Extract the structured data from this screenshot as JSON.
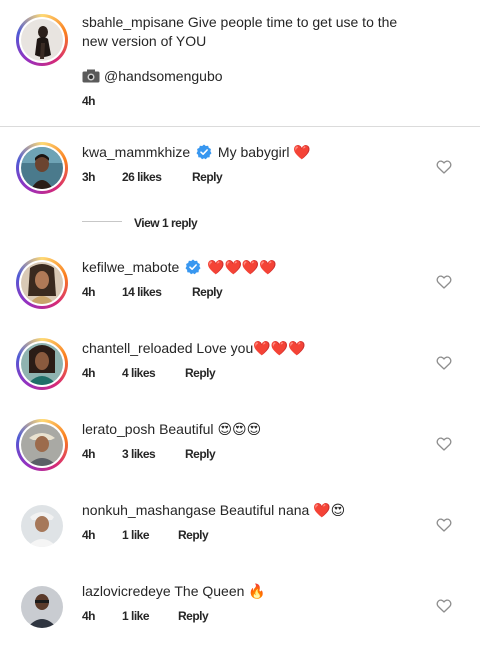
{
  "caption": {
    "username": "sbahle_mpisane",
    "text_line1": "Give people time to get use to the",
    "text_line2": "new version of YOU",
    "credit": "@handsomengubo",
    "time": "4h"
  },
  "comments": [
    {
      "username": "kwa_mammkhize",
      "verified": true,
      "text": "My babygirl",
      "emojis": "❤️",
      "time": "3h",
      "likes": "26 likes",
      "reply": "Reply"
    },
    {
      "username": "kefilwe_mabote",
      "verified": true,
      "text": "",
      "emojis": "❤️❤️❤️❤️",
      "time": "4h",
      "likes": "14 likes",
      "reply": "Reply"
    },
    {
      "username": "chantell_reloaded",
      "verified": false,
      "text": "Love you",
      "emojis": "❤️❤️❤️",
      "time": "4h",
      "likes": "4 likes",
      "reply": "Reply"
    },
    {
      "username": "lerato_posh",
      "verified": false,
      "text": "Beautiful",
      "emojis": "😍😍😍",
      "time": "4h",
      "likes": "3 likes",
      "reply": "Reply"
    },
    {
      "username": "nonkuh_mashangase",
      "verified": false,
      "text": "Beautiful nana",
      "emojis": "❤️😍",
      "time": "4h",
      "likes": "1 like",
      "reply": "Reply"
    },
    {
      "username": "lazlovicredeye",
      "verified": false,
      "text": "The Queen",
      "emojis": "🔥",
      "time": "4h",
      "likes": "1 like",
      "reply": "Reply"
    }
  ],
  "view_replies": "View 1 reply",
  "colors": {
    "heart_red": "#ed4956",
    "verified_blue": "#3897f0"
  }
}
